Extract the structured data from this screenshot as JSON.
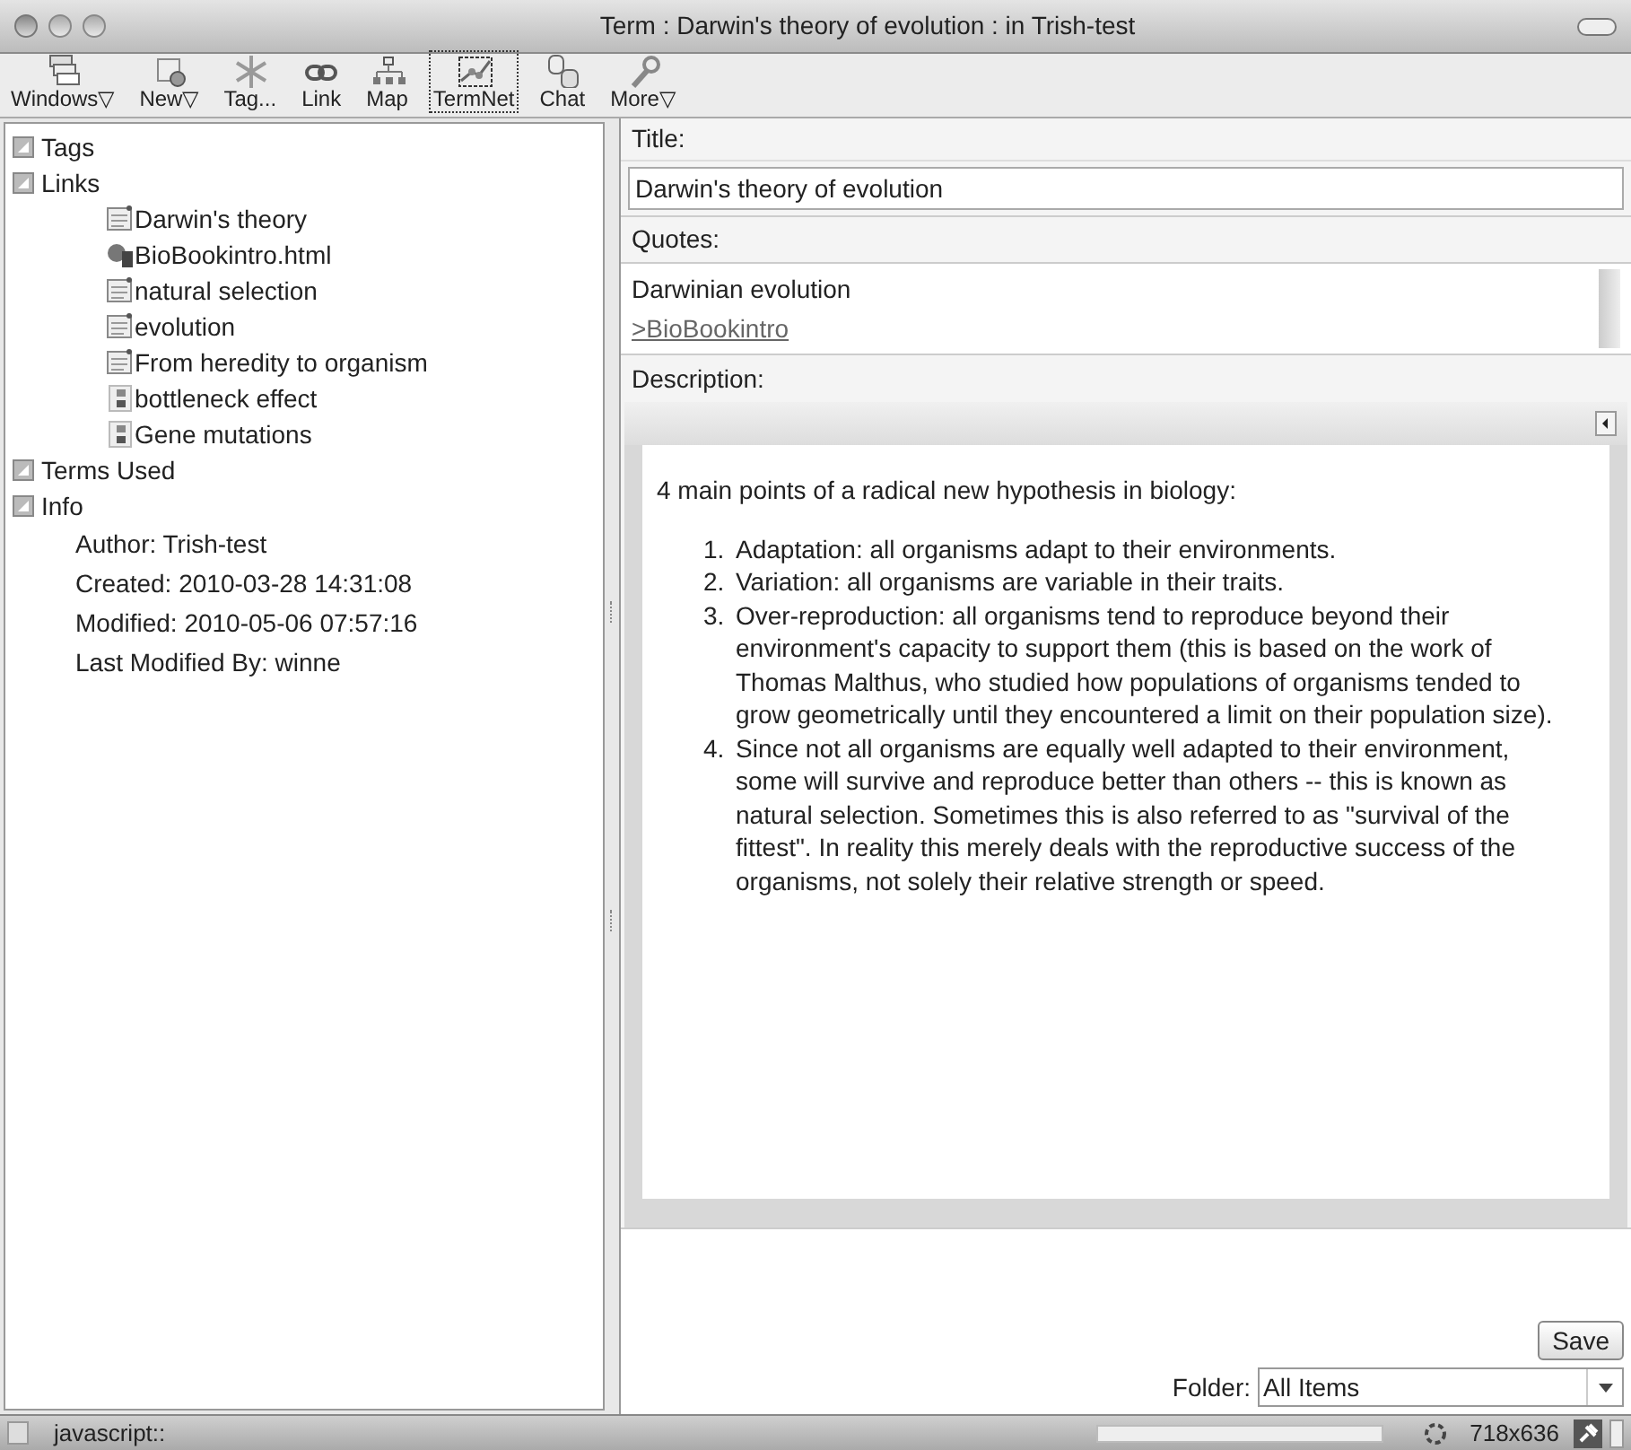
{
  "window": {
    "title": "Term : Darwin's theory of evolution : in Trish-test"
  },
  "toolbar": [
    {
      "kind": "windows",
      "label": "Windows▽",
      "selected": false
    },
    {
      "kind": "new",
      "label": "New▽",
      "selected": false
    },
    {
      "kind": "tag",
      "label": "Tag...",
      "selected": false
    },
    {
      "kind": "link",
      "label": "Link",
      "selected": false
    },
    {
      "kind": "map",
      "label": "Map",
      "selected": false
    },
    {
      "kind": "termnet",
      "label": "TermNet",
      "selected": true
    },
    {
      "kind": "chat",
      "label": "Chat",
      "selected": false
    },
    {
      "kind": "more",
      "label": "More▽",
      "selected": false
    }
  ],
  "sidebar": {
    "sections": [
      {
        "label": "Tags",
        "expanded": true
      },
      {
        "label": "Links",
        "expanded": true,
        "children": [
          {
            "kind": "note",
            "label": "Darwin's theory"
          },
          {
            "kind": "web",
            "label": "BioBookintro.html"
          },
          {
            "kind": "note",
            "label": "natural selection"
          },
          {
            "kind": "note",
            "label": "evolution"
          },
          {
            "kind": "note",
            "label": "From heredity to organism"
          },
          {
            "kind": "term",
            "label": "bottleneck effect"
          },
          {
            "kind": "term",
            "label": "Gene mutations"
          }
        ]
      },
      {
        "label": "Terms Used",
        "expanded": true
      },
      {
        "label": "Info",
        "expanded": true,
        "children": [
          {
            "kind": "text",
            "label": "Author: Trish-test"
          },
          {
            "kind": "text",
            "label": "Created: 2010-03-28 14:31:08"
          },
          {
            "kind": "text",
            "label": "Modified: 2010-05-06 07:57:16"
          },
          {
            "kind": "text",
            "label": "Last Modified By: winne"
          }
        ]
      }
    ]
  },
  "form": {
    "title_label": "Title:",
    "title_value": "Darwin's theory of evolution",
    "quotes_label": "Quotes:",
    "quote_text": "Darwinian evolution",
    "quote_link": ">BioBookintro",
    "description_label": "Description:",
    "description_intro": "4 main points of a radical new hypothesis in biology:",
    "description_points": [
      {
        "number": "1.",
        "text": "Adaptation: all organisms adapt to their environments."
      },
      {
        "number": "2.",
        "text": "Variation: all organisms are variable in their traits."
      },
      {
        "number": "3.",
        "text": "Over-reproduction: all organisms tend to reproduce beyond their environment's capacity to support them (this is based on the work of Thomas Malthus, who studied how populations of organisms tended to grow geometrically until they encountered a limit on their population size)."
      },
      {
        "number": "4.",
        "text": "Since not all organisms are equally well adapted to their environment, some will survive and reproduce better than others -- this is known as natural selection. Sometimes this is also referred to as \"survival of the fittest\". In reality this merely deals with the reproductive success of the organisms, not solely their relative strength or speed."
      }
    ],
    "save_button": "Save",
    "folder_label": "Folder:",
    "folder_value": "All Items"
  },
  "status_bar": {
    "url": "javascript::",
    "size": "718x636"
  }
}
